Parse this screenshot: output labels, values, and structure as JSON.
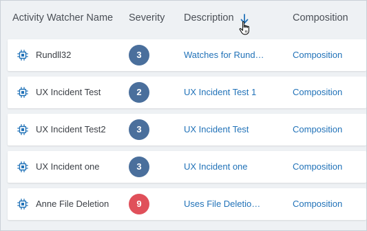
{
  "columns": {
    "name": "Activity Watcher Name",
    "severity": "Severity",
    "description": "Description",
    "composition": "Composition"
  },
  "sort": {
    "column": "description",
    "direction": "descending",
    "icon": "arrow-down-icon"
  },
  "colors": {
    "link": "#2172b8",
    "badge_default": "#4a6f9c",
    "badge_high": "#e0505a"
  },
  "rows": [
    {
      "name": "Rundll32",
      "severity": "3",
      "severity_level": "default",
      "description": "Watches for Rund…",
      "composition": "Composition"
    },
    {
      "name": "UX Incident Test",
      "severity": "2",
      "severity_level": "default",
      "description": "UX Incident Test 1",
      "composition": "Composition"
    },
    {
      "name": "UX Incident Test2",
      "severity": "3",
      "severity_level": "default",
      "description": "UX Incident Test",
      "composition": "Composition"
    },
    {
      "name": "UX Incident one",
      "severity": "3",
      "severity_level": "default",
      "description": "UX Incident one",
      "composition": "Composition"
    },
    {
      "name": "Anne File Deletion",
      "severity": "9",
      "severity_level": "high",
      "description": "Uses File Deletio…",
      "composition": "Composition"
    }
  ]
}
